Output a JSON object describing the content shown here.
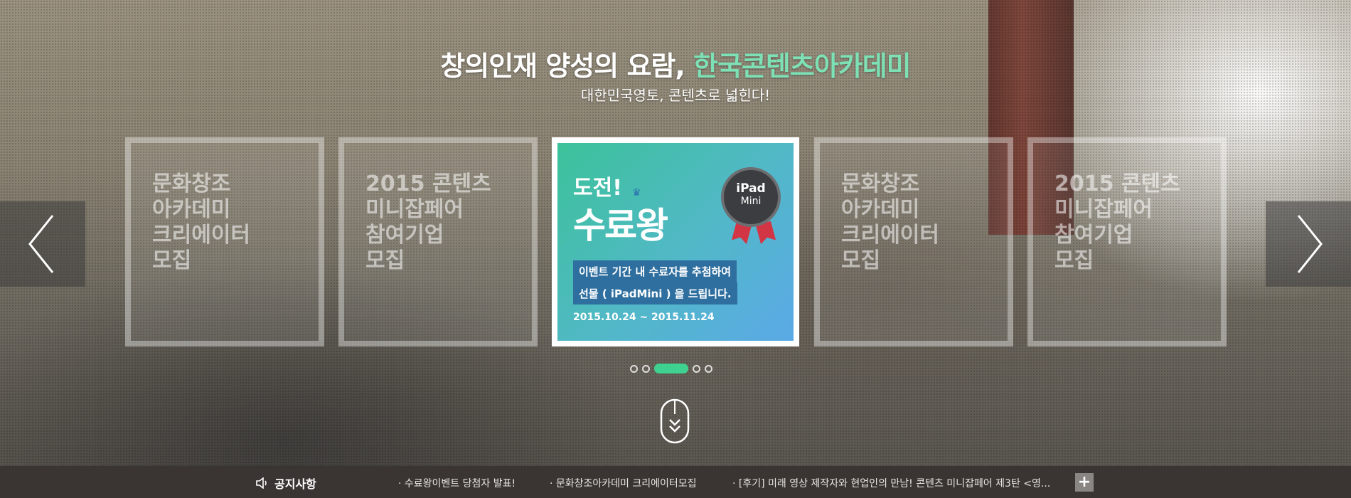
{
  "hero": {
    "headline_main": "창의인재 양성의 요람, ",
    "headline_accent": "한국콘텐츠아카데미",
    "subline": "대한민국영토, 콘텐츠로 넓힌다!"
  },
  "slides": [
    {
      "text": "문화창조\n아카데미\n크리에이터\n모집"
    },
    {
      "text": "2015 콘텐츠\n미니잡페어\n참여기업\n모집"
    },
    {
      "challenge": "도전!",
      "title": "수료왕",
      "crown": "♛",
      "badge_line1": "iPad",
      "badge_line2": "Mini",
      "tag1": "이벤트 기간 내 수료자를 추첨하여",
      "tag2": "선물 ( iPadMini ) 을 드립니다.",
      "dates": "2015.10.24 ~ 2015.11.24"
    },
    {
      "text": "문화창조\n아카데미\n크리에이터\n모집"
    },
    {
      "text": "2015 콘텐츠\n미니잡페어\n참여기업\n모집"
    }
  ],
  "pager": {
    "count": 5,
    "active_index": 2
  },
  "notice": {
    "label": "공지사항",
    "items": [
      "· 수료왕이벤트 당첨자 발표!",
      "· 문화창조아카데미 크리에이터모집",
      "· [후기] 미래 영상 제작자와 현업인의 만남! 콘텐츠 미니잡페어 제3탄 <영..."
    ],
    "more": "+"
  },
  "colors": {
    "accent": "#7ee0b5",
    "pager_active": "#3fd18f",
    "notice_bg": "#3a3533"
  }
}
